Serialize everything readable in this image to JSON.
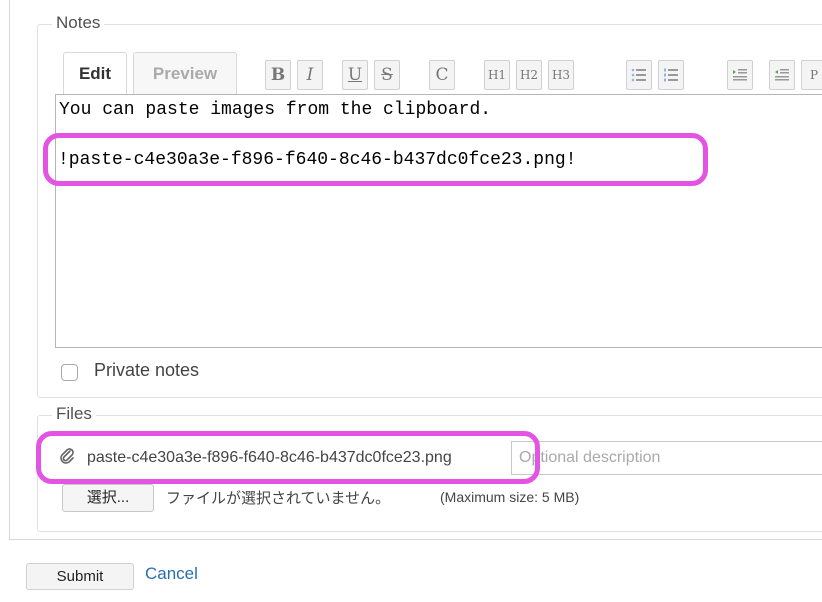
{
  "notes": {
    "legend": "Notes",
    "tabs": {
      "edit": "Edit",
      "preview": "Preview"
    },
    "toolbar": {
      "bold": "B",
      "italic": "I",
      "underline": "U",
      "strike": "S",
      "code": "C",
      "h1": "H1",
      "h2": "H2",
      "h3": "H3",
      "icons": [
        "bullet-list-icon",
        "numbered-list-icon",
        "indent-icon",
        "outdent-icon",
        "pre-icon"
      ],
      "pre_partial": "P"
    },
    "editor": {
      "line1": "You can paste images from the clipboard.",
      "line2": "!paste-c4e30a3e-f896-f640-8c46-b437dc0fce23.png!"
    },
    "private_label": "Private notes",
    "private_checked": false
  },
  "files": {
    "legend": "Files",
    "attachment_name": "paste-c4e30a3e-f896-f640-8c46-b437dc0fce23.png",
    "description_placeholder": "Optional description",
    "choose_button": "選択...",
    "no_file_text": "ファイルが選択されていません。",
    "max_size": "(Maximum size: 5 MB)"
  },
  "actions": {
    "submit": "Submit",
    "cancel": "Cancel"
  },
  "colors": {
    "highlight": "#e354e3",
    "link": "#2a6eaa"
  }
}
